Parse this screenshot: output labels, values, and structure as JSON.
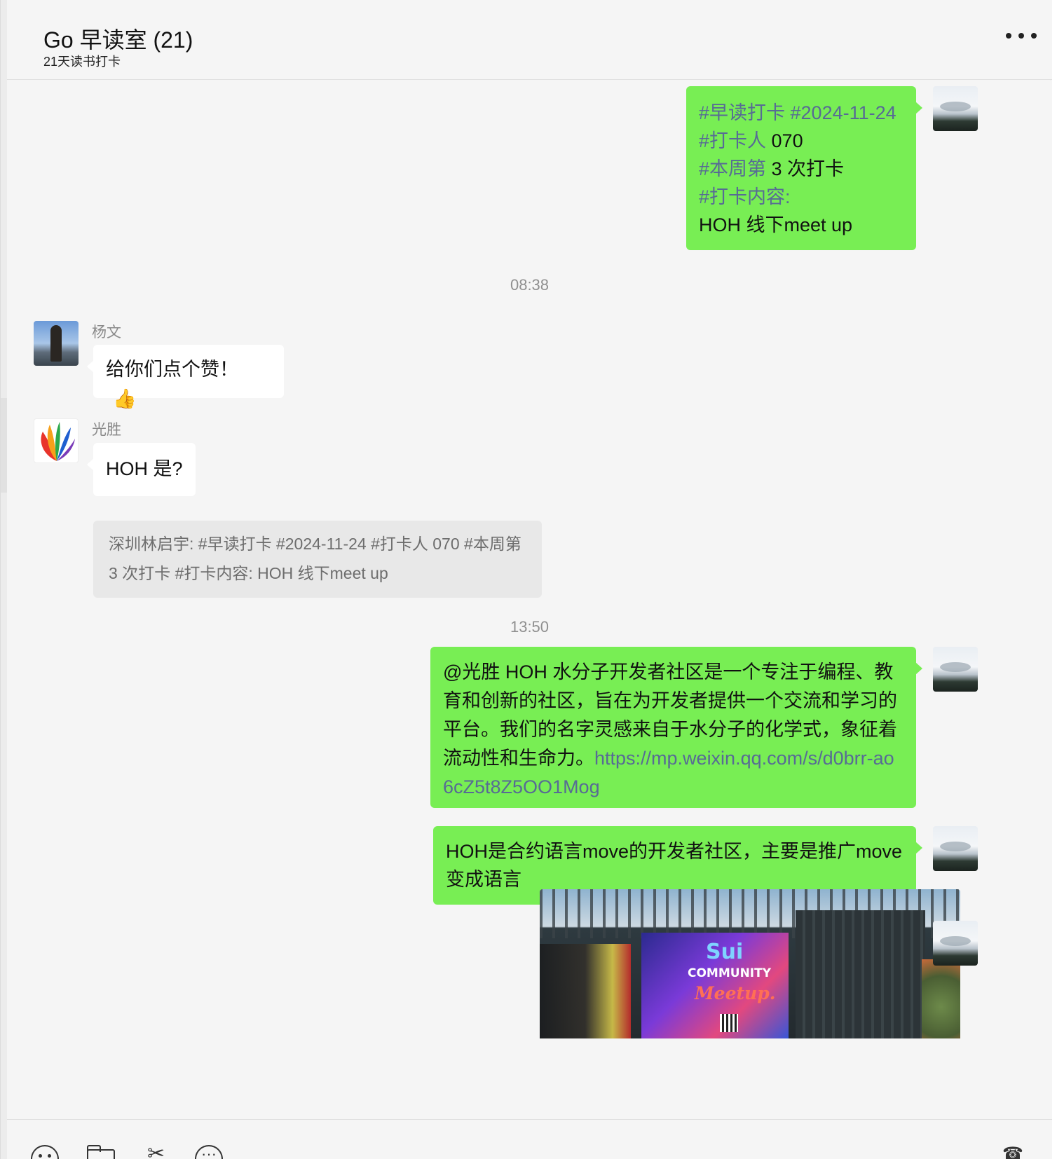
{
  "window": {
    "title": "Go 早读室 (21)",
    "subtitle": "21天读书打卡"
  },
  "colors": {
    "self_bubble": "#78ee54",
    "other_bubble": "#ffffff",
    "link": "#576b95",
    "background": "#f5f5f5"
  },
  "messages": {
    "m1": {
      "tag1": "#早读打卡 #2024-11-24",
      "tag2": "#打卡人",
      "tag2_value": " 070",
      "tag3": "#本周第",
      "tag3_value": " 3 次打卡",
      "tag4": "#打卡内容:",
      "text": "HOH 线下meet up"
    },
    "time1": "08:38",
    "m2": {
      "sender": "杨文",
      "text": "给你们点个赞！",
      "emoji": "👍"
    },
    "m3": {
      "sender": "光胜",
      "text": "HOH 是?",
      "quote": "深圳林启宇: #早读打卡 #2024-11-24 #打卡人 070 #本周第 3 次打卡 #打卡内容:  HOH 线下meet up"
    },
    "time2": "13:50",
    "m4": {
      "text": "@光胜 HOH 水分子开发者社区是一个专注于编程、教育和创新的社区，旨在为开发者提供一个交流和学习的平台。我们的名字灵感来自于水分子的化学式，象征着流动性和生命力。",
      "link": "https://mp.weixin.qq.com/s/d0brr-ao6cZ5t8Z5OO1Mog"
    },
    "m5": {
      "text": "HOH是合约语言move的开发者社区，主要是推广move变成语言"
    },
    "m6": {
      "poster_line1": "Sui",
      "poster_line2": "COMMUNITY",
      "poster_line3": "Meetup."
    }
  },
  "toolbar": {
    "icons": [
      "smile-icon",
      "folder-icon",
      "scissors-icon",
      "chat-history-icon",
      "phone-icon"
    ]
  }
}
